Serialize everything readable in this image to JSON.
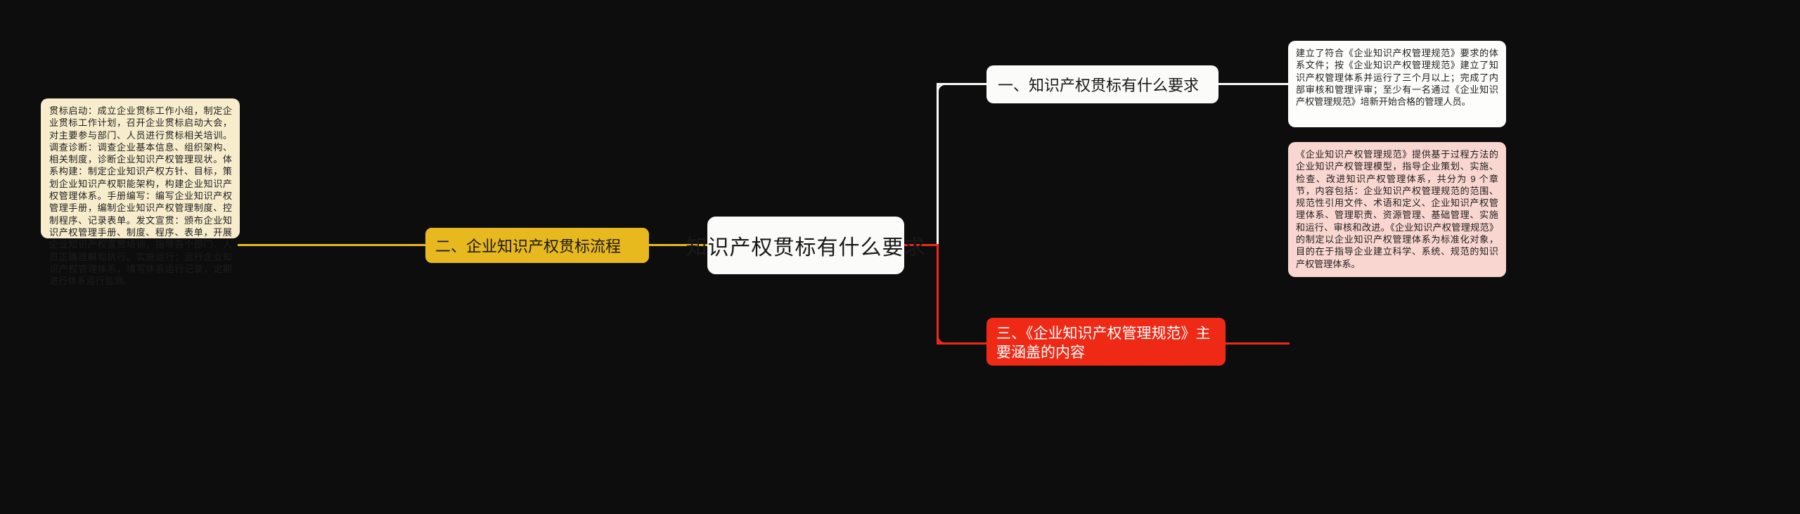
{
  "theme": {
    "background": "#0d0d0d",
    "root_bg": "#fbfbf9",
    "yellow": "#e8b81f",
    "beige": "#f7edcd",
    "red": "#ee2a16",
    "pink": "#fad6d0",
    "white": "#fdfdfc",
    "text_dark": "#1d1d1d",
    "text_light": "#ffffff"
  },
  "root": {
    "label": "知识产权贯标有什么要求"
  },
  "branches": {
    "left": {
      "node_label": "二、企业知识产权贯标流程",
      "detail": "贯标启动：成立企业贯标工作小组，制定企业贯标工作计划，召开企业贯标启动大会，对主要参与部门、人员进行贯标相关培训。调查诊断：调查企业基本信息、组织架构、相关制度，诊断企业知识产权管理现状。体系构建：制定企业知识产权方针、目标，策划企业知识产权职能架构，构建企业知识产权管理体系。手册编写：编写企业知识产权管理手册，编制企业知识产权管理制度、控制程序、记录表单。发文宣贯：颁布企业知识产权管理手册、制度、程序、表单，开展企业知识产权宣贯培训，指导各个部门、人员正确理解和执行。实施运行：运行企业知识产权管理体系，填写体系运行记录，定期进行体系运行监测。"
    },
    "right_top": {
      "node_label": "一、知识产权贯标有什么要求",
      "detail": "建立了符合《企业知识产权管理规范》要求的体系文件；按《企业知识产权管理规范》建立了知识产权管理体系并运行了三个月以上；完成了内部审核和管理评审；至少有一名通过《企业知识产权管理规范》培新开始合格的管理人员。"
    },
    "right_bottom": {
      "node_label": "三、《企业知识产权管理规范》主要涵盖的内容",
      "detail": "《企业知识产权管理规范》提供基于过程方法的企业知识产权管理模型，指导企业策划、实施、检查、改进知识产权管理体系，共分为 9 个章节，内容包括：企业知识产权管理规范的范围、规范性引用文件、术语和定义、企业知识产权管理体系、管理职责、资源管理、基础管理、实施和运行、审核和改进。《企业知识产权管理规范》的制定以企业知识产权管理体系为标准化对象，目的在于指导企业建立科学、系统、规范的知识产权管理体系。"
    }
  }
}
